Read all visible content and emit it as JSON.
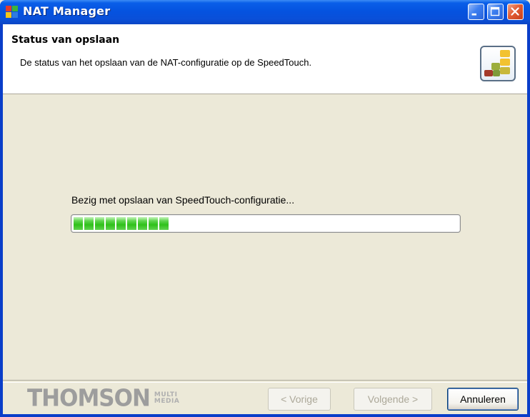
{
  "window": {
    "title": "NAT Manager"
  },
  "header": {
    "title": "Status van opslaan",
    "subtitle": "De status van het opslaan van de NAT-configuratie op de SpeedTouch."
  },
  "progress": {
    "label": "Bezig met opslaan van SpeedTouch-configuratie...",
    "value_fraction": 0.25
  },
  "footer": {
    "logo_word": "THOMSON",
    "logo_tag_1": "MULTI",
    "logo_tag_2": "MEDIA",
    "buttons": {
      "back": "< Vorige",
      "next": "Volgende >",
      "cancel": "Annuleren"
    }
  },
  "colors": {
    "titlebar": "#0553e0",
    "progress_green": "#2fc11a",
    "dialog_bg": "#ece9d8"
  },
  "icons": {
    "app": "nat-manager-app-icon",
    "header": "speedtouch-blocks-icon"
  }
}
